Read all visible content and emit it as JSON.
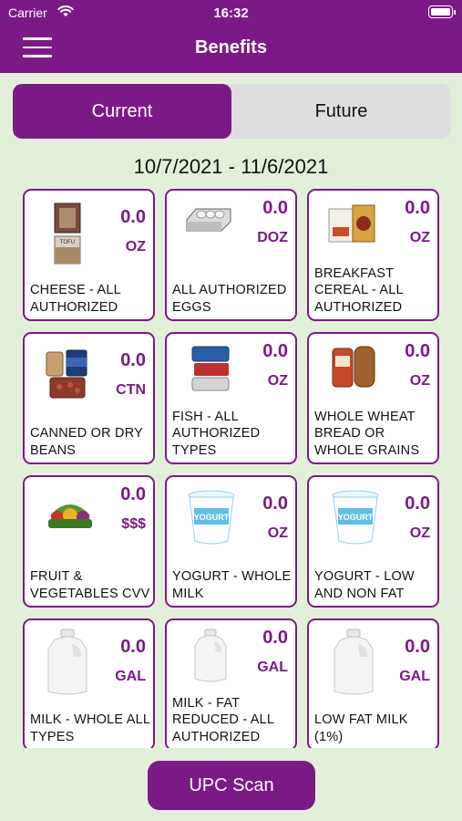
{
  "status_bar": {
    "carrier": "Carrier",
    "time": "16:32"
  },
  "header": {
    "title": "Benefits",
    "menu_icon": "hamburger-menu-icon"
  },
  "tabs": [
    {
      "label": "Current",
      "selected": true
    },
    {
      "label": "Future",
      "selected": false
    }
  ],
  "period": "10/7/2021 - 11/6/2021",
  "colors": {
    "brand": "#7b1a86",
    "background": "#e2f0d9"
  },
  "benefits": [
    {
      "name": "CHEESE - ALL AUTHORIZED",
      "qty": "0.0",
      "unit": "OZ",
      "icon": "cheese-icon"
    },
    {
      "name": "ALL AUTHORIZED EGGS",
      "qty": "0.0",
      "unit": "DOZ",
      "icon": "eggs-icon"
    },
    {
      "name": "BREAKFAST CEREAL - ALL AUTHORIZED",
      "qty": "0.0",
      "unit": "OZ",
      "icon": "cereal-icon"
    },
    {
      "name": "CANNED OR DRY BEANS",
      "qty": "0.0",
      "unit": "CTN",
      "icon": "beans-icon"
    },
    {
      "name": "FISH - ALL AUTHORIZED TYPES",
      "qty": "0.0",
      "unit": "OZ",
      "icon": "canned-fish-icon"
    },
    {
      "name": "WHOLE WHEAT BREAD OR WHOLE GRAINS",
      "qty": "0.0",
      "unit": "OZ",
      "icon": "bread-icon"
    },
    {
      "name": "FRUIT & VEGETABLES CVV",
      "qty": "0.0",
      "unit": "$$$",
      "icon": "produce-icon"
    },
    {
      "name": "YOGURT - WHOLE MILK",
      "qty": "0.0",
      "unit": "OZ",
      "icon": "yogurt-icon"
    },
    {
      "name": "YOGURT - LOW AND NON FAT",
      "qty": "0.0",
      "unit": "OZ",
      "icon": "yogurt-icon"
    },
    {
      "name": "MILK - WHOLE ALL TYPES",
      "qty": "0.0",
      "unit": "GAL",
      "icon": "milk-jug-icon"
    },
    {
      "name": "MILK - FAT REDUCED - ALL AUTHORIZED",
      "qty": "0.0",
      "unit": "GAL",
      "icon": "milk-jug-icon"
    },
    {
      "name": "LOW FAT MILK (1%)",
      "qty": "0.0",
      "unit": "GAL",
      "icon": "milk-jug-icon"
    }
  ],
  "actions": {
    "scan_label": "UPC Scan"
  }
}
